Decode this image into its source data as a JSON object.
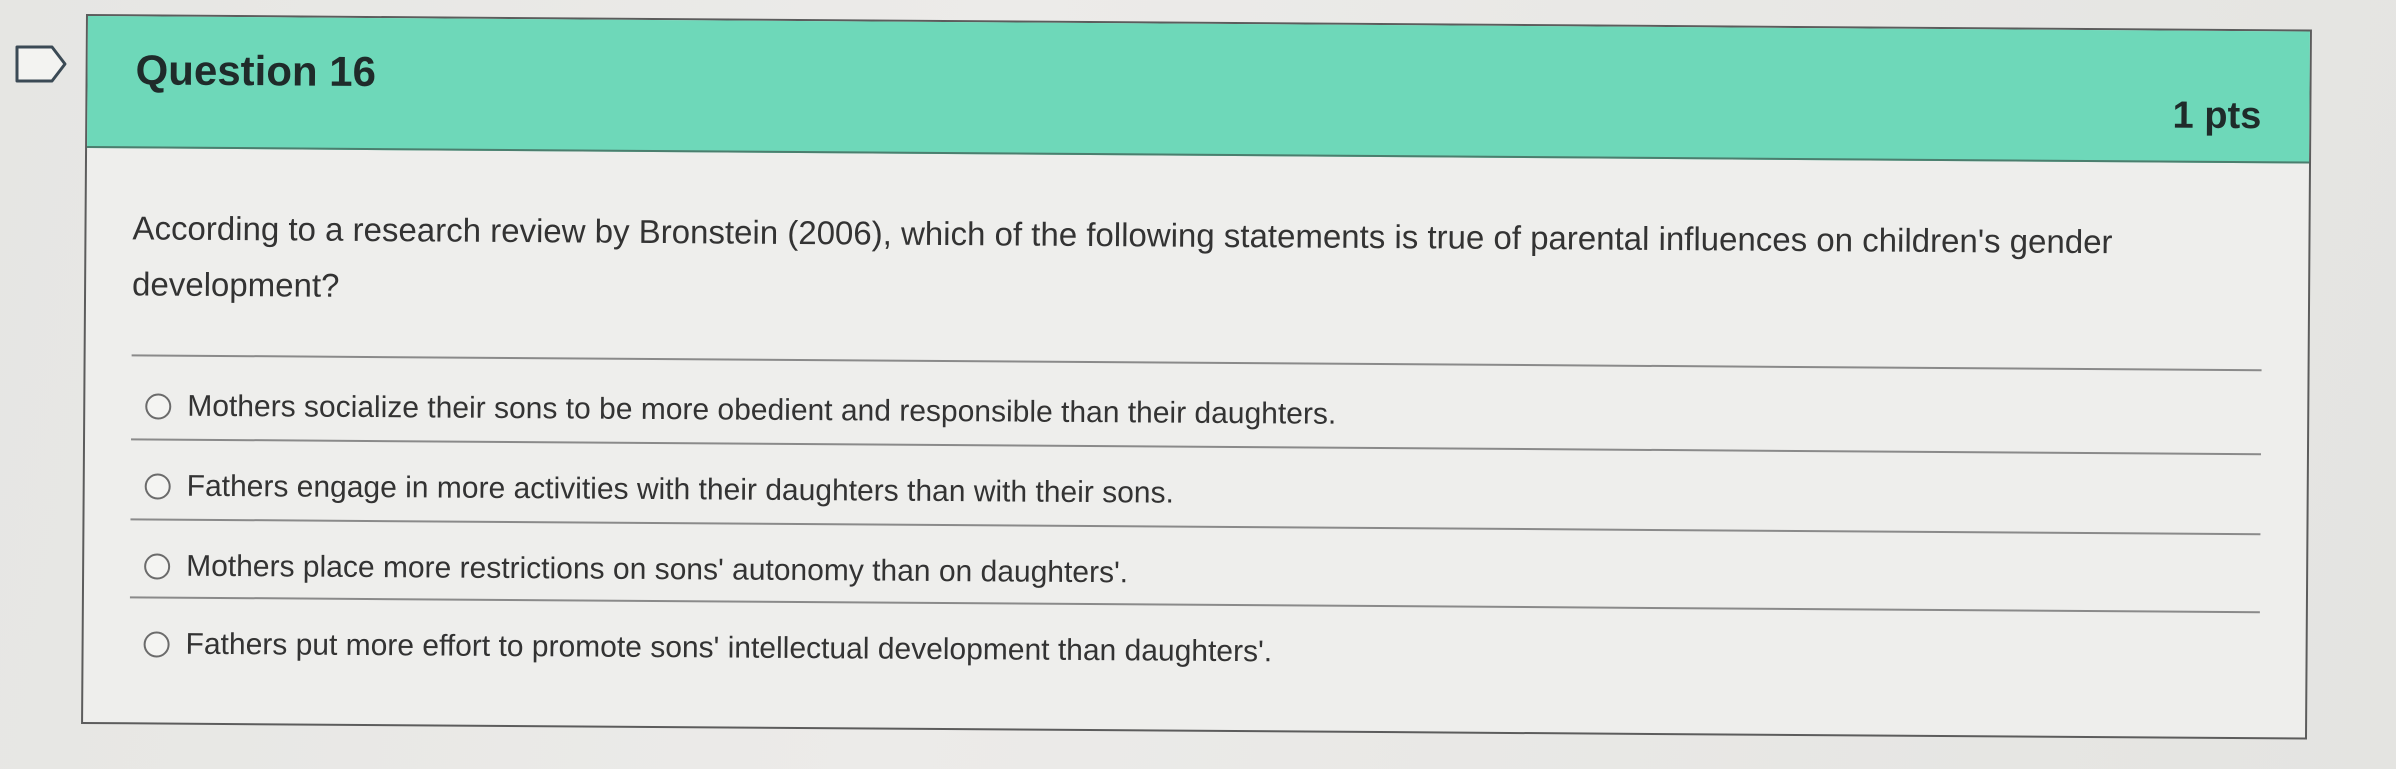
{
  "question": {
    "title": "Question 16",
    "points": "1 pts",
    "prompt": "According to a research review by Bronstein (2006), which of the following statements is true of parental influences on children's gender development?"
  },
  "answers": [
    {
      "label": "Mothers socialize their sons to be more obedient and responsible than their daughters."
    },
    {
      "label": "Fathers engage in more activities with their daughters than with their sons."
    },
    {
      "label": "Mothers place more restrictions on sons' autonomy than on daughters'."
    },
    {
      "label": "Fathers put more effort to promote sons' intellectual development than daughters'."
    }
  ],
  "icons": {
    "flag": "bookmark-flag-icon",
    "radio": "radio-unselected-icon"
  },
  "colors": {
    "header": "#6ed8b9",
    "text": "#333333"
  }
}
